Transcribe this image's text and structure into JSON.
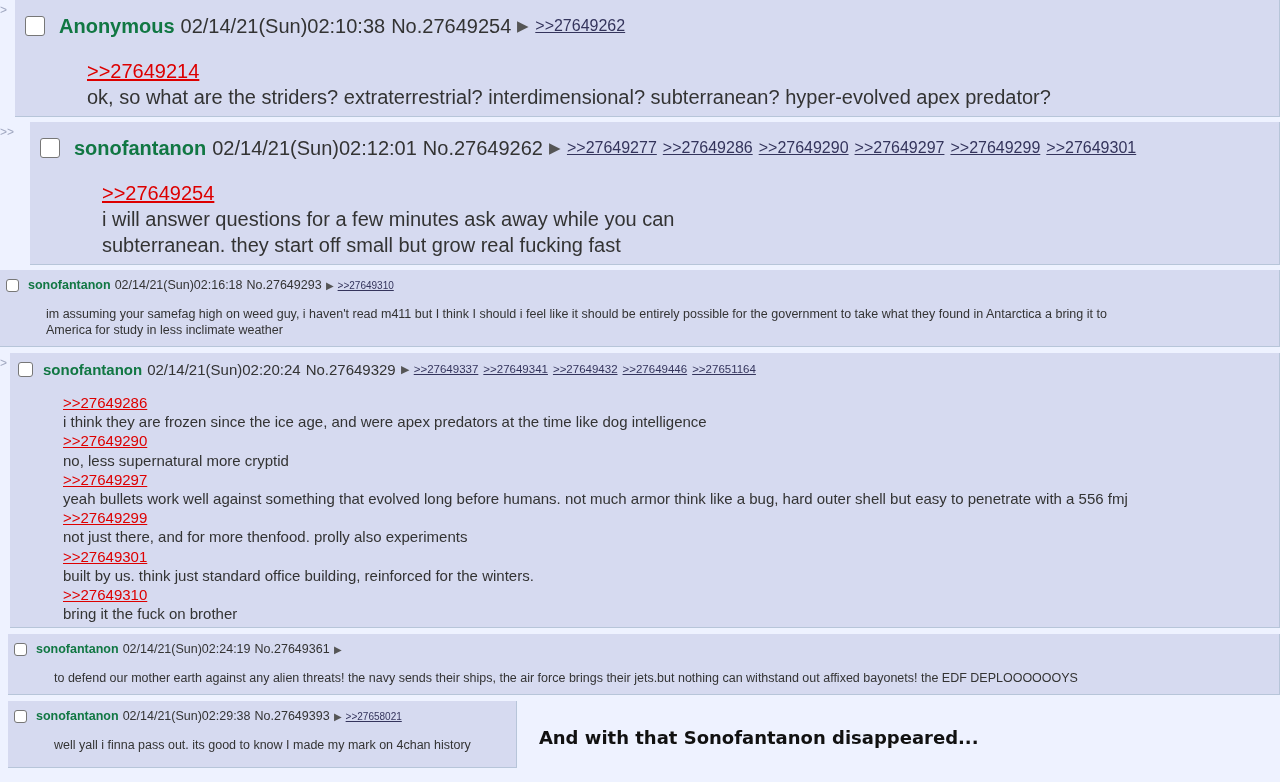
{
  "posts": [
    {
      "kind": "large",
      "side_mark": ">",
      "checked": false,
      "name": "Anonymous",
      "datetime": "02/14/21(Sun)02:10:38",
      "number": "No.27649254",
      "arrow": "▶",
      "backlinks": [
        ">>27649262"
      ],
      "lines": [
        {
          "kind": "quote",
          "text": ">>27649214"
        },
        {
          "kind": "text",
          "text": "ok, so what are the striders? extraterrestrial? interdimensional? subterranean? hyper-evolved apex predator?"
        }
      ]
    },
    {
      "kind": "large",
      "side_mark": ">>",
      "checked": false,
      "name": "sonofantanon",
      "datetime": "02/14/21(Sun)02:12:01",
      "number": "No.27649262",
      "arrow": "▶",
      "backlinks": [
        ">>27649277",
        ">>27649286",
        ">>27649290",
        ">>27649297",
        ">>27649299",
        ">>27649301"
      ],
      "lines": [
        {
          "kind": "quote",
          "text": ">>27649254"
        },
        {
          "kind": "text",
          "text": "i will answer questions for a few minutes ask away while you can"
        },
        {
          "kind": "text",
          "text": "subterranean. they start off small but grow real fucking fast"
        }
      ]
    },
    {
      "kind": "small",
      "checked": false,
      "name": "sonofantanon",
      "datetime": "02/14/21(Sun)02:16:18",
      "number": "No.27649293",
      "arrow": "▶",
      "backlinks": [
        ">>27649310"
      ],
      "lines": [
        {
          "kind": "text",
          "text": "im assuming your samefag high on weed guy, i haven't read m411 but I think I should i feel like it should be entirely possible for the government to take what they found in Antarctica a bring it to"
        },
        {
          "kind": "text",
          "text": "America for study in less inclimate weather"
        }
      ]
    },
    {
      "kind": "medium",
      "side_mark": ">",
      "checked": false,
      "name": "sonofantanon",
      "datetime": "02/14/21(Sun)02:20:24",
      "number": "No.27649329",
      "arrow": "▶",
      "backlinks": [
        ">>27649337",
        ">>27649341",
        ">>27649432",
        ">>27649446",
        ">>27651164"
      ],
      "lines": [
        {
          "kind": "quote",
          "text": ">>27649286"
        },
        {
          "kind": "text",
          "text": "i think they are frozen since the ice age, and were apex predators at the time like dog intelligence"
        },
        {
          "kind": "quote",
          "text": ">>27649290"
        },
        {
          "kind": "text",
          "text": "no, less supernatural more cryptid"
        },
        {
          "kind": "quote",
          "text": ">>27649297"
        },
        {
          "kind": "text",
          "text": "yeah bullets work well against something that evolved long before humans. not much armor think like a bug, hard outer shell but easy to penetrate with a 556 fmj"
        },
        {
          "kind": "quote",
          "text": ">>27649299"
        },
        {
          "kind": "text",
          "text": "not just there, and for more thenfood. prolly also experiments"
        },
        {
          "kind": "quote",
          "text": ">>27649301"
        },
        {
          "kind": "text",
          "text": "built by us. think just standard office building, reinforced for the winters."
        },
        {
          "kind": "quote",
          "text": ">>27649310"
        },
        {
          "kind": "text",
          "text": "bring it the fuck on brother"
        }
      ]
    },
    {
      "kind": "small",
      "checked": false,
      "name": "sonofantanon",
      "datetime": "02/14/21(Sun)02:24:19",
      "number": "No.27649361",
      "arrow": "▶",
      "lines": [
        {
          "kind": "text",
          "text": "to defend our mother earth against any alien threats! the navy sends their ships, the air force brings their jets.but nothing can withstand out affixed bayonets! the EDF DEPLOOOOOOYS"
        }
      ]
    },
    {
      "kind": "small",
      "checked": false,
      "name": "sonofantanon",
      "datetime": "02/14/21(Sun)02:29:38",
      "number": "No.27649393",
      "arrow": "▶",
      "backlinks": [
        ">>27658021"
      ],
      "lines": [
        {
          "kind": "text",
          "text": "well yall i finna pass out. its good to know I made my mark on 4chan history"
        }
      ]
    }
  ],
  "caption": "And with that Sonofantanon disappeared..."
}
